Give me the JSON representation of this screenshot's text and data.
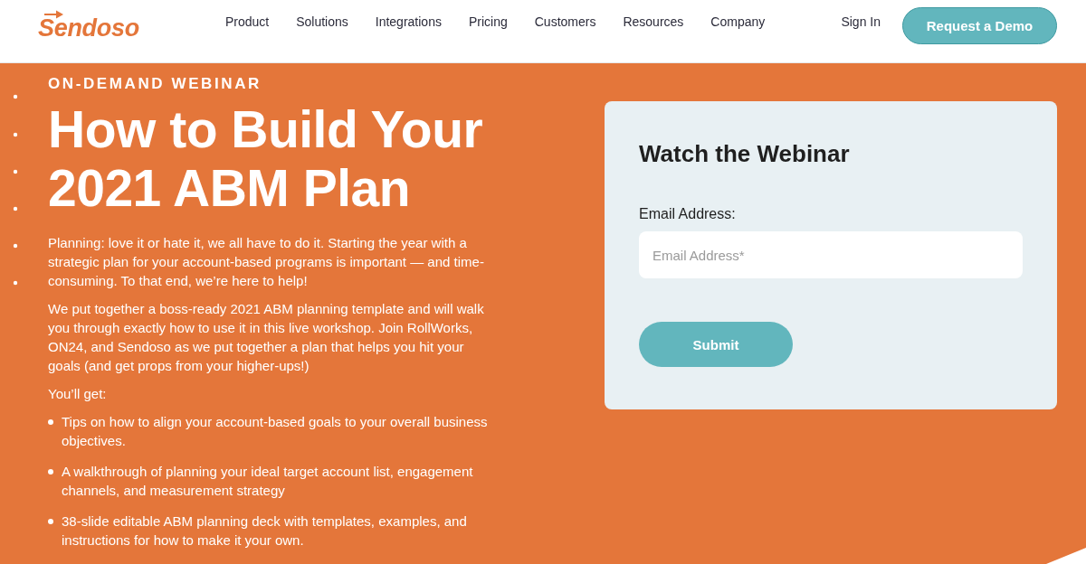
{
  "header": {
    "logo": "Sendoso",
    "nav": [
      "Product",
      "Solutions",
      "Integrations",
      "Pricing",
      "Customers",
      "Resources",
      "Company"
    ],
    "sign_in": "Sign In",
    "cta": "Request a Demo"
  },
  "hero": {
    "eyebrow": "ON-DEMAND WEBINAR",
    "title": "How to Build Your 2021 ABM Plan",
    "paragraphs": [
      "Planning: love it or hate it, we all have to do it. Starting the year with a strategic plan for your account-based programs is important — and time-consuming. To that end, we’re here to help!",
      "We put together a boss-ready 2021 ABM planning template and will walk you through exactly how to use it in this live workshop. Join RollWorks, ON24, and Sendoso as we put together a plan that helps you hit your goals (and get props from your higher-ups!)"
    ],
    "list_intro": "You’ll get:",
    "bullets": [
      "Tips on how to align your account-based goals to your overall business objectives.",
      "A walkthrough of planning your ideal target account list, engagement channels, and measurement strategy",
      "38-slide editable ABM planning deck with templates, examples, and instructions for how to make it your own."
    ]
  },
  "form": {
    "title": "Watch the Webinar",
    "label": "Email Address:",
    "placeholder": "Email Address*",
    "submit": "Submit"
  }
}
